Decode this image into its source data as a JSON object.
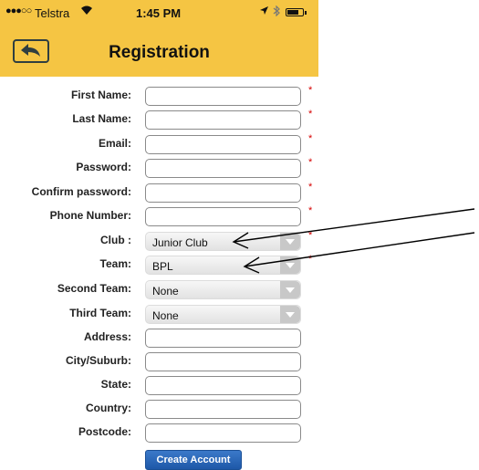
{
  "status_bar": {
    "signal": "●●●○○",
    "carrier": "Telstra",
    "wifi_icon": "wifi-icon",
    "time": "1:45 PM"
  },
  "nav": {
    "title": "Registration",
    "back_icon": "back-arrow-icon"
  },
  "form": {
    "required_mark": "*",
    "first_name_label": "First Name:",
    "last_name_label": "Last Name:",
    "email_label": "Email:",
    "password_label": "Password:",
    "confirm_password_label": "Confirm password:",
    "phone_label": "Phone Number:",
    "club_label": "Club :",
    "club_value": "Junior Club",
    "team_label": "Team:",
    "team_value": "BPL",
    "second_team_label": "Second Team:",
    "second_team_value": "None",
    "third_team_label": "Third Team:",
    "third_team_value": "None",
    "address_label": "Address:",
    "city_label": "City/Suburb:",
    "state_label": "State:",
    "country_label": "Country:",
    "postcode_label": "Postcode:",
    "submit_label": "Create Account"
  },
  "colors": {
    "header": "#f5c543",
    "required": "#d60000",
    "button": "#2a66b8"
  }
}
